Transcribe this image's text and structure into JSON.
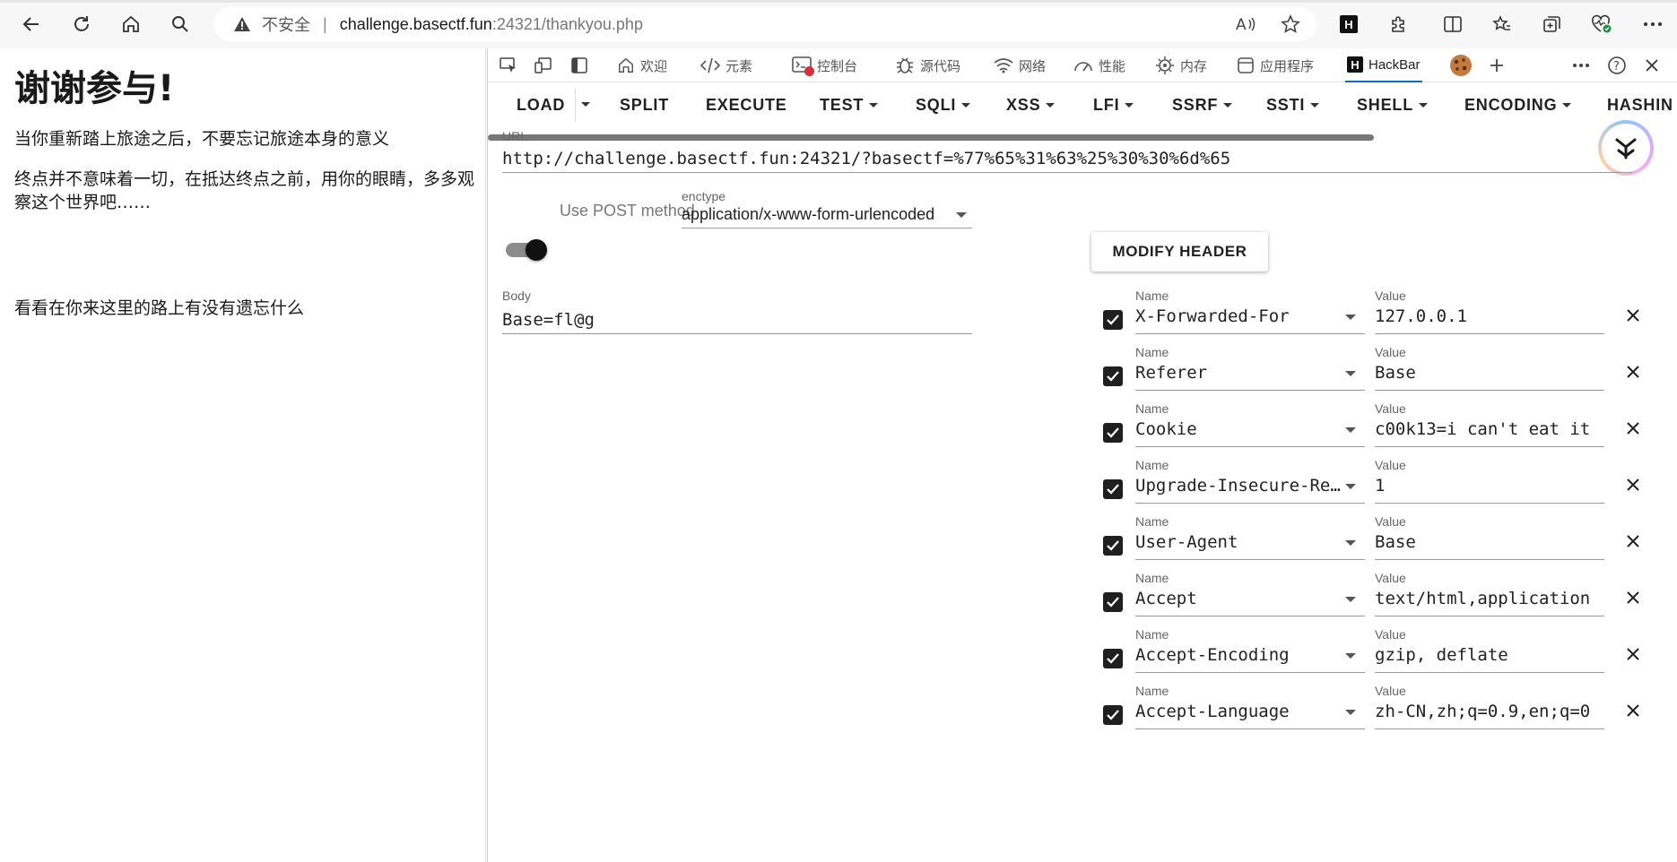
{
  "browser": {
    "insecure_label": "不安全",
    "url_host": "challenge.basectf.fun",
    "url_path": ":24321/thankyou.php"
  },
  "page": {
    "heading": "谢谢参与!",
    "line1": "当你重新踏上旅途之后，不要忘记旅途本身的意义",
    "line2": "终点并不意味着一切，在抵达终点之前，用你的眼睛，多多观察这个世界吧……",
    "line3": "看看在你来这里的路上有没有遗忘什么"
  },
  "devtools": {
    "tabs": [
      {
        "label": "欢迎",
        "icon": "home-icon"
      },
      {
        "label": "元素",
        "icon": "code-icon"
      },
      {
        "label": "控制台",
        "icon": "console-icon"
      },
      {
        "label": "源代码",
        "icon": "bug-icon"
      },
      {
        "label": "网络",
        "icon": "wifi-icon"
      },
      {
        "label": "性能",
        "icon": "gauge-icon"
      },
      {
        "label": "内存",
        "icon": "memory-icon"
      },
      {
        "label": "应用程序",
        "icon": "app-icon"
      },
      {
        "label": "HackBar",
        "icon": "hackbar-logo-icon"
      }
    ]
  },
  "hackbar": {
    "menu": {
      "load": "LOAD",
      "split": "SPLIT",
      "execute": "EXECUTE",
      "test": "TEST",
      "sqli": "SQLI",
      "xss": "XSS",
      "lfi": "LFI",
      "ssrf": "SSRF",
      "ssti": "SSTI",
      "shell": "SHELL",
      "encoding": "ENCODING",
      "hashing": "HASHIN"
    },
    "url_label": "URL",
    "url_value": "http://challenge.basectf.fun:24321/?basectf=%77%65%31%63%25%30%30%6d%65",
    "post_label": "Use POST method",
    "enctype_label": "enctype",
    "enctype_value": "application/x-www-form-urlencoded",
    "modify_header": "MODIFY HEADER",
    "body_label": "Body",
    "body_value": "Base=fl@g",
    "header_name_label": "Name",
    "header_value_label": "Value",
    "headers": [
      {
        "name": "X-Forwarded-For",
        "value": "127.0.0.1"
      },
      {
        "name": "Referer",
        "value": "Base"
      },
      {
        "name": "Cookie",
        "value": "c00k13=i can't eat it"
      },
      {
        "name": "Upgrade-Insecure-Requests",
        "value": "1"
      },
      {
        "name": "User-Agent",
        "value": "Base"
      },
      {
        "name": "Accept",
        "value": "text/html,application"
      },
      {
        "name": "Accept-Encoding",
        "value": "gzip, deflate"
      },
      {
        "name": "Accept-Language",
        "value": "zh-CN,zh;q=0.9,en;q=0"
      }
    ]
  }
}
